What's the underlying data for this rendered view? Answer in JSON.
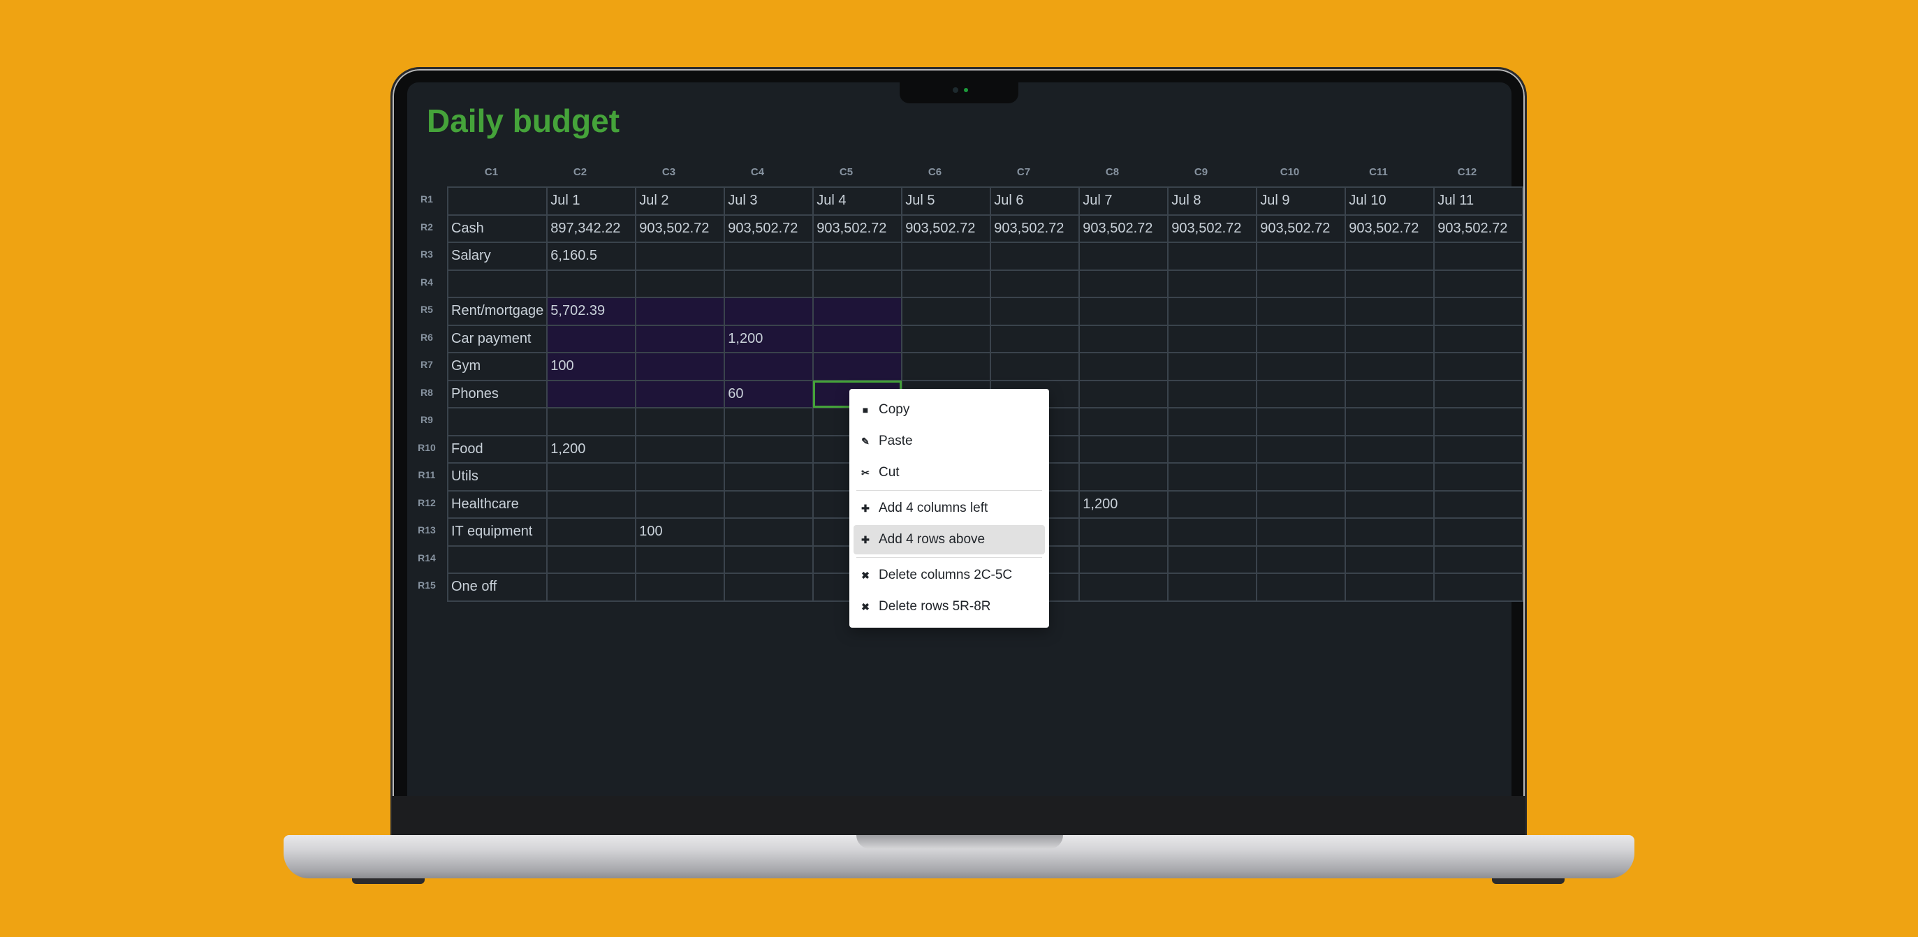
{
  "title": "Daily budget",
  "columns": [
    "C1",
    "C2",
    "C3",
    "C4",
    "C5",
    "C6",
    "C7",
    "C8",
    "C9",
    "C10",
    "C11",
    "C12"
  ],
  "rows": [
    {
      "label": "R1",
      "cells": [
        "",
        "Jul 1",
        "Jul 2",
        "Jul 3",
        "Jul 4",
        "Jul 5",
        "Jul 6",
        "Jul 7",
        "Jul 8",
        "Jul 9",
        "Jul 10",
        "Jul 11"
      ]
    },
    {
      "label": "R2",
      "cells": [
        "Cash",
        "897,342.22",
        "903,502.72",
        "903,502.72",
        "903,502.72",
        "903,502.72",
        "903,502.72",
        "903,502.72",
        "903,502.72",
        "903,502.72",
        "903,502.72",
        "903,502.72"
      ]
    },
    {
      "label": "R3",
      "cells": [
        "Salary",
        "6,160.5",
        "",
        "",
        "",
        "",
        "",
        "",
        "",
        "",
        "",
        ""
      ]
    },
    {
      "label": "R4",
      "cells": [
        "",
        "",
        "",
        "",
        "",
        "",
        "",
        "",
        "",
        "",
        "",
        ""
      ]
    },
    {
      "label": "R5",
      "cells": [
        "Rent/mortgage",
        "5,702.39",
        "",
        "",
        "",
        "",
        "",
        "",
        "",
        "",
        "",
        ""
      ]
    },
    {
      "label": "R6",
      "cells": [
        "Car payment",
        "",
        "",
        "1,200",
        "",
        "",
        "",
        "",
        "",
        "",
        "",
        ""
      ]
    },
    {
      "label": "R7",
      "cells": [
        "Gym",
        "100",
        "",
        "",
        "",
        "",
        "",
        "",
        "",
        "",
        "",
        ""
      ]
    },
    {
      "label": "R8",
      "cells": [
        "Phones",
        "",
        "",
        "60",
        "",
        "",
        "",
        "",
        "",
        "",
        "",
        ""
      ]
    },
    {
      "label": "R9",
      "cells": [
        "",
        "",
        "",
        "",
        "",
        "",
        "",
        "",
        "",
        "",
        "",
        ""
      ]
    },
    {
      "label": "R10",
      "cells": [
        "Food",
        "1,200",
        "",
        "",
        "",
        "",
        "",
        "",
        "",
        "",
        "",
        ""
      ]
    },
    {
      "label": "R11",
      "cells": [
        "Utils",
        "",
        "",
        "",
        "",
        "",
        "",
        "",
        "",
        "",
        "",
        ""
      ]
    },
    {
      "label": "R12",
      "cells": [
        "Healthcare",
        "",
        "",
        "",
        "",
        "",
        "",
        "1,200",
        "",
        "",
        "",
        ""
      ]
    },
    {
      "label": "R13",
      "cells": [
        "IT equipment",
        "",
        "100",
        "",
        "",
        "",
        "",
        "",
        "",
        "",
        "",
        ""
      ]
    },
    {
      "label": "R14",
      "cells": [
        "",
        "",
        "",
        "",
        "",
        "",
        "",
        "",
        "",
        "",
        "",
        ""
      ]
    },
    {
      "label": "R15",
      "cells": [
        "One off",
        "",
        "",
        "",
        "",
        "",
        "",
        "",
        "",
        "",
        "",
        ""
      ]
    }
  ],
  "selection": {
    "range": "2C-5C x 5R-8R",
    "active_cell": "C5R8"
  },
  "context_menu": {
    "items": [
      {
        "label": "Copy",
        "icon": "clipboard-icon"
      },
      {
        "label": "Paste",
        "icon": "paste-brush-icon"
      },
      {
        "label": "Cut",
        "icon": "scissors-icon"
      },
      {
        "label": "Add 4 columns left",
        "icon": "plus-icon"
      },
      {
        "label": "Add 4 rows above",
        "icon": "plus-icon",
        "highlighted": true
      },
      {
        "label": "Delete columns 2C-5C",
        "icon": "trash-icon"
      },
      {
        "label": "Delete rows 5R-8R",
        "icon": "trash-icon"
      }
    ]
  },
  "colors": {
    "background": "#EFA312",
    "title": "#45A33A",
    "selection": "#1E1438",
    "screen": "#1A1F24"
  }
}
